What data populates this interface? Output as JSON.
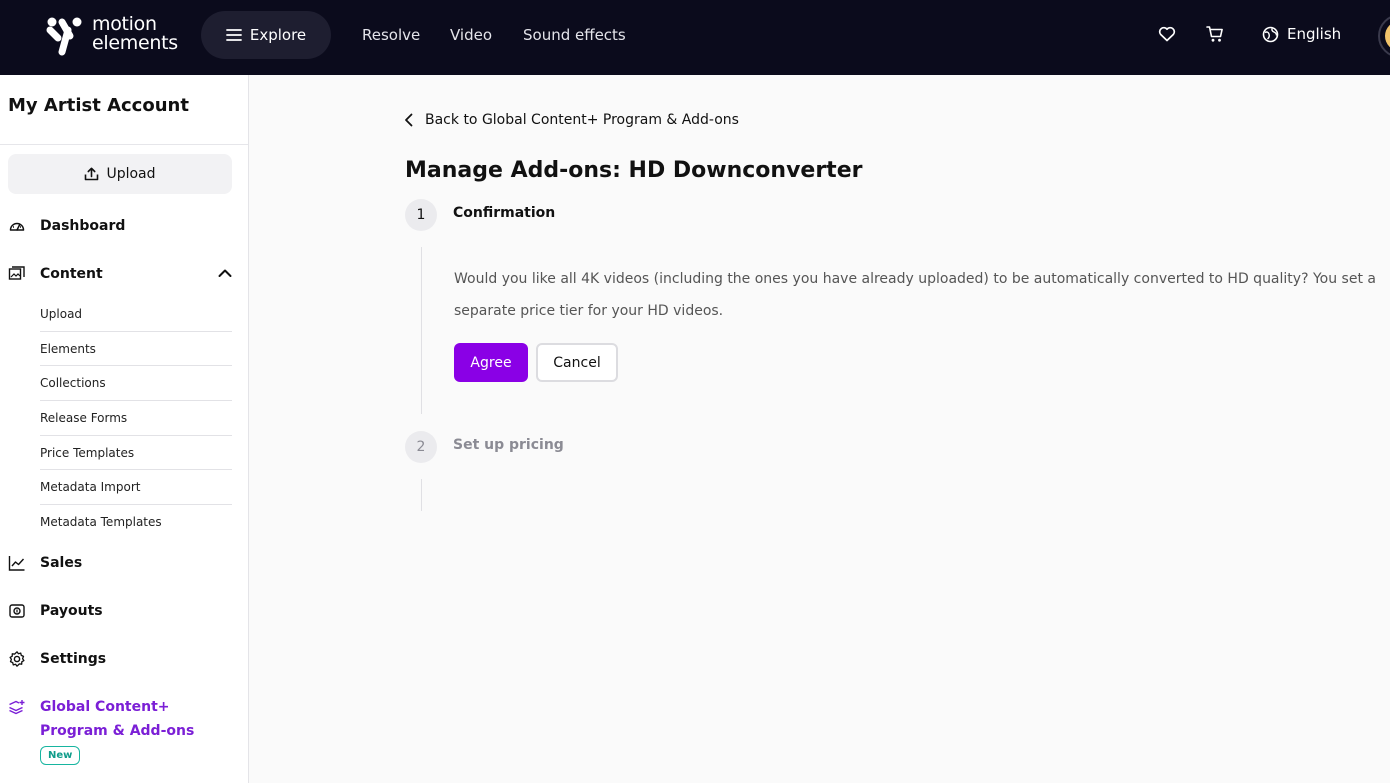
{
  "header": {
    "logo_text_line1": "motion",
    "logo_text_line2": "elements",
    "explore_label": "Explore",
    "nav_links": [
      "Resolve",
      "Video",
      "Sound effects"
    ],
    "language_label": "English",
    "icons": [
      "heart-icon",
      "cart-icon",
      "globe-icon",
      "menu-icon"
    ]
  },
  "sidebar": {
    "title": "My Artist Account",
    "upload_label": "Upload",
    "items": {
      "dashboard": "Dashboard",
      "content": "Content",
      "sales": "Sales",
      "payouts": "Payouts",
      "settings": "Settings",
      "global": "Global Content+ Program & Add-ons"
    },
    "content_expanded": true,
    "content_subitems": [
      "Upload",
      "Elements",
      "Collections",
      "Release Forms",
      "Price Templates",
      "Metadata Import",
      "Metadata Templates"
    ],
    "new_badge": "New",
    "active_item": "global"
  },
  "main": {
    "back_link": "Back to Global Content+ Program & Add-ons",
    "title": "Manage Add-ons: HD Downconverter",
    "steps": [
      {
        "number": "1",
        "label": "Confirmation",
        "description": "Would you like all 4K videos (including the ones you have already uploaded) to be automatically converted to HD quality? You set a separate price tier for your HD videos.",
        "agree_label": "Agree",
        "cancel_label": "Cancel"
      },
      {
        "number": "2",
        "label": "Set up pricing"
      }
    ]
  },
  "colors": {
    "topbar_bg": "#0b0b1c",
    "accent": "#8a00e6",
    "active_nav": "#7b1fd6",
    "badge": "#17b5a0"
  }
}
